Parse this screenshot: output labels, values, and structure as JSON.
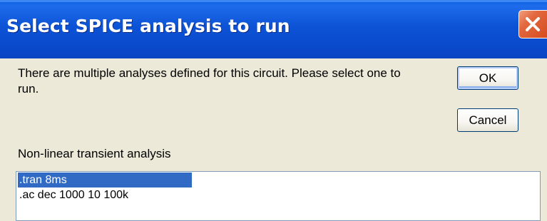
{
  "window": {
    "title": "Select SPICE analysis to run",
    "close_icon": "close-icon",
    "colors": {
      "titlebar": "#0A49CB",
      "close_button": "#D64B1F",
      "dialog_background": "#ECE9D8",
      "selection": "#316AC5"
    }
  },
  "message": "There are multiple analyses defined for this circuit.  Please select one to run.",
  "buttons": {
    "ok_label": "OK",
    "cancel_label": "Cancel"
  },
  "analysis_description": "Non-linear transient analysis",
  "analyses": [
    {
      "label": ".tran 8ms",
      "selected": true
    },
    {
      "label": ".ac dec 1000 10 100k",
      "selected": false
    }
  ]
}
